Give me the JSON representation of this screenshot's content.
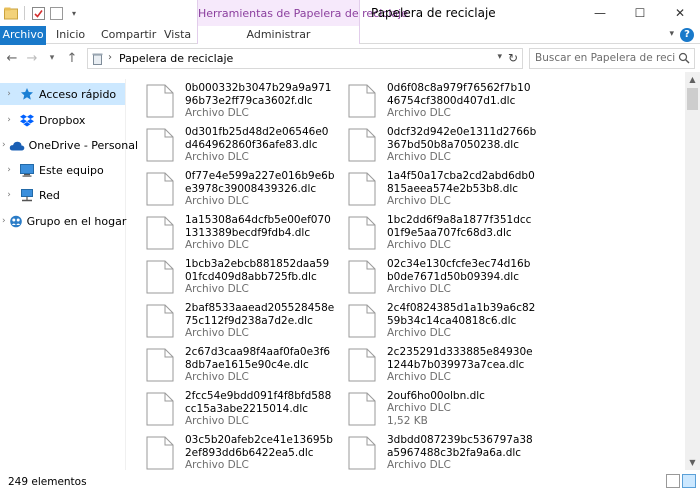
{
  "window": {
    "title": "Papelera de reciclaje",
    "context_group": "Herramientas de Papelera de reciclaje",
    "minimize": "—",
    "maximize": "☐",
    "close": "✕"
  },
  "ribbon": {
    "tabs": [
      {
        "label": "Archivo"
      },
      {
        "label": "Inicio"
      },
      {
        "label": "Compartir"
      },
      {
        "label": "Vista"
      },
      {
        "label": "Administrar"
      }
    ],
    "help": "?"
  },
  "address": {
    "path": "Papelera de reciclaje",
    "search_placeholder": "Buscar en Papelera de reciclaje"
  },
  "sidebar": {
    "items": [
      {
        "label": "Acceso rápido",
        "icon": "star-icon",
        "color": "#1a7fd4"
      },
      {
        "label": "Dropbox",
        "icon": "dropbox-icon",
        "color": "#0061ff"
      },
      {
        "label": "OneDrive - Personal",
        "icon": "cloud-icon",
        "color": "#1a5fb4"
      },
      {
        "label": "Este equipo",
        "icon": "computer-icon",
        "color": "#2a7cc7"
      },
      {
        "label": "Red",
        "icon": "network-icon",
        "color": "#2a7cc7"
      },
      {
        "label": "Grupo en el hogar",
        "icon": "homegroup-icon",
        "color": "#2a7cc7"
      }
    ]
  },
  "files": {
    "left": [
      {
        "name": "0b000332b3047b29a9a97196b73e2ff79ca3602f.dlc",
        "type": "Archivo DLC"
      },
      {
        "name": "0d301fb25d48d2e06546e0d464962860f36afe83.dlc",
        "type": "Archivo DLC"
      },
      {
        "name": "0f77e4e599a227e016b9e6be3978c39008439326.dlc",
        "type": "Archivo DLC"
      },
      {
        "name": "1a15308a64dcfb5e00ef0701313389becdf9fdb4.dlc",
        "type": "Archivo DLC"
      },
      {
        "name": "1bcb3a2ebcb881852daa5901fcd409d8abb725fb.dlc",
        "type": "Archivo DLC"
      },
      {
        "name": "2baf8533aaead205528458e75c112f9d238a7d2e.dlc",
        "type": "Archivo DLC"
      },
      {
        "name": "2c67d3caa98f4aaf0fa0e3f68db7ae1615e90c4e.dlc",
        "type": "Archivo DLC"
      },
      {
        "name": "2fcc54e9bdd091f4f8bfd588cc15a3abe2215014.dlc",
        "type": "Archivo DLC"
      },
      {
        "name": "03c5b20afeb2ce41e13695b2ef893dd6b6422ea5.dlc",
        "type": "Archivo DLC"
      }
    ],
    "right": [
      {
        "name": "0d6f08c8a979f76562f7b1046754cf3800d407d1.dlc",
        "type": "Archivo DLC"
      },
      {
        "name": "0dcf32d942e0e1311d2766b367bd50b8a7050238.dlc",
        "type": "Archivo DLC"
      },
      {
        "name": "1a4f50a17cba2cd2abd6db0815aeea574e2b53b8.dlc",
        "type": "Archivo DLC"
      },
      {
        "name": "1bc2dd6f9a8a1877f351dcc01f9e5aa707fc68d3.dlc",
        "type": "Archivo DLC"
      },
      {
        "name": "02c34e130cfcfe3ec74d16bb0de7671d50b09394.dlc",
        "type": "Archivo DLC"
      },
      {
        "name": "2c4f0824385d1a1b39a6c8259b34c14ca40818c6.dlc",
        "type": "Archivo DLC"
      },
      {
        "name": "2c235291d333885e84930e1244b7b039973a7cea.dlc",
        "type": "Archivo DLC"
      },
      {
        "name": "2ouf6ho00olbn.dlc",
        "type": "Archivo DLC",
        "size": "1,52 KB"
      },
      {
        "name": "3dbdd087239bc536797a38a5967488c3b2fa9a6a.dlc",
        "type": "Archivo DLC"
      }
    ]
  },
  "status": {
    "count": "249 elementos"
  }
}
